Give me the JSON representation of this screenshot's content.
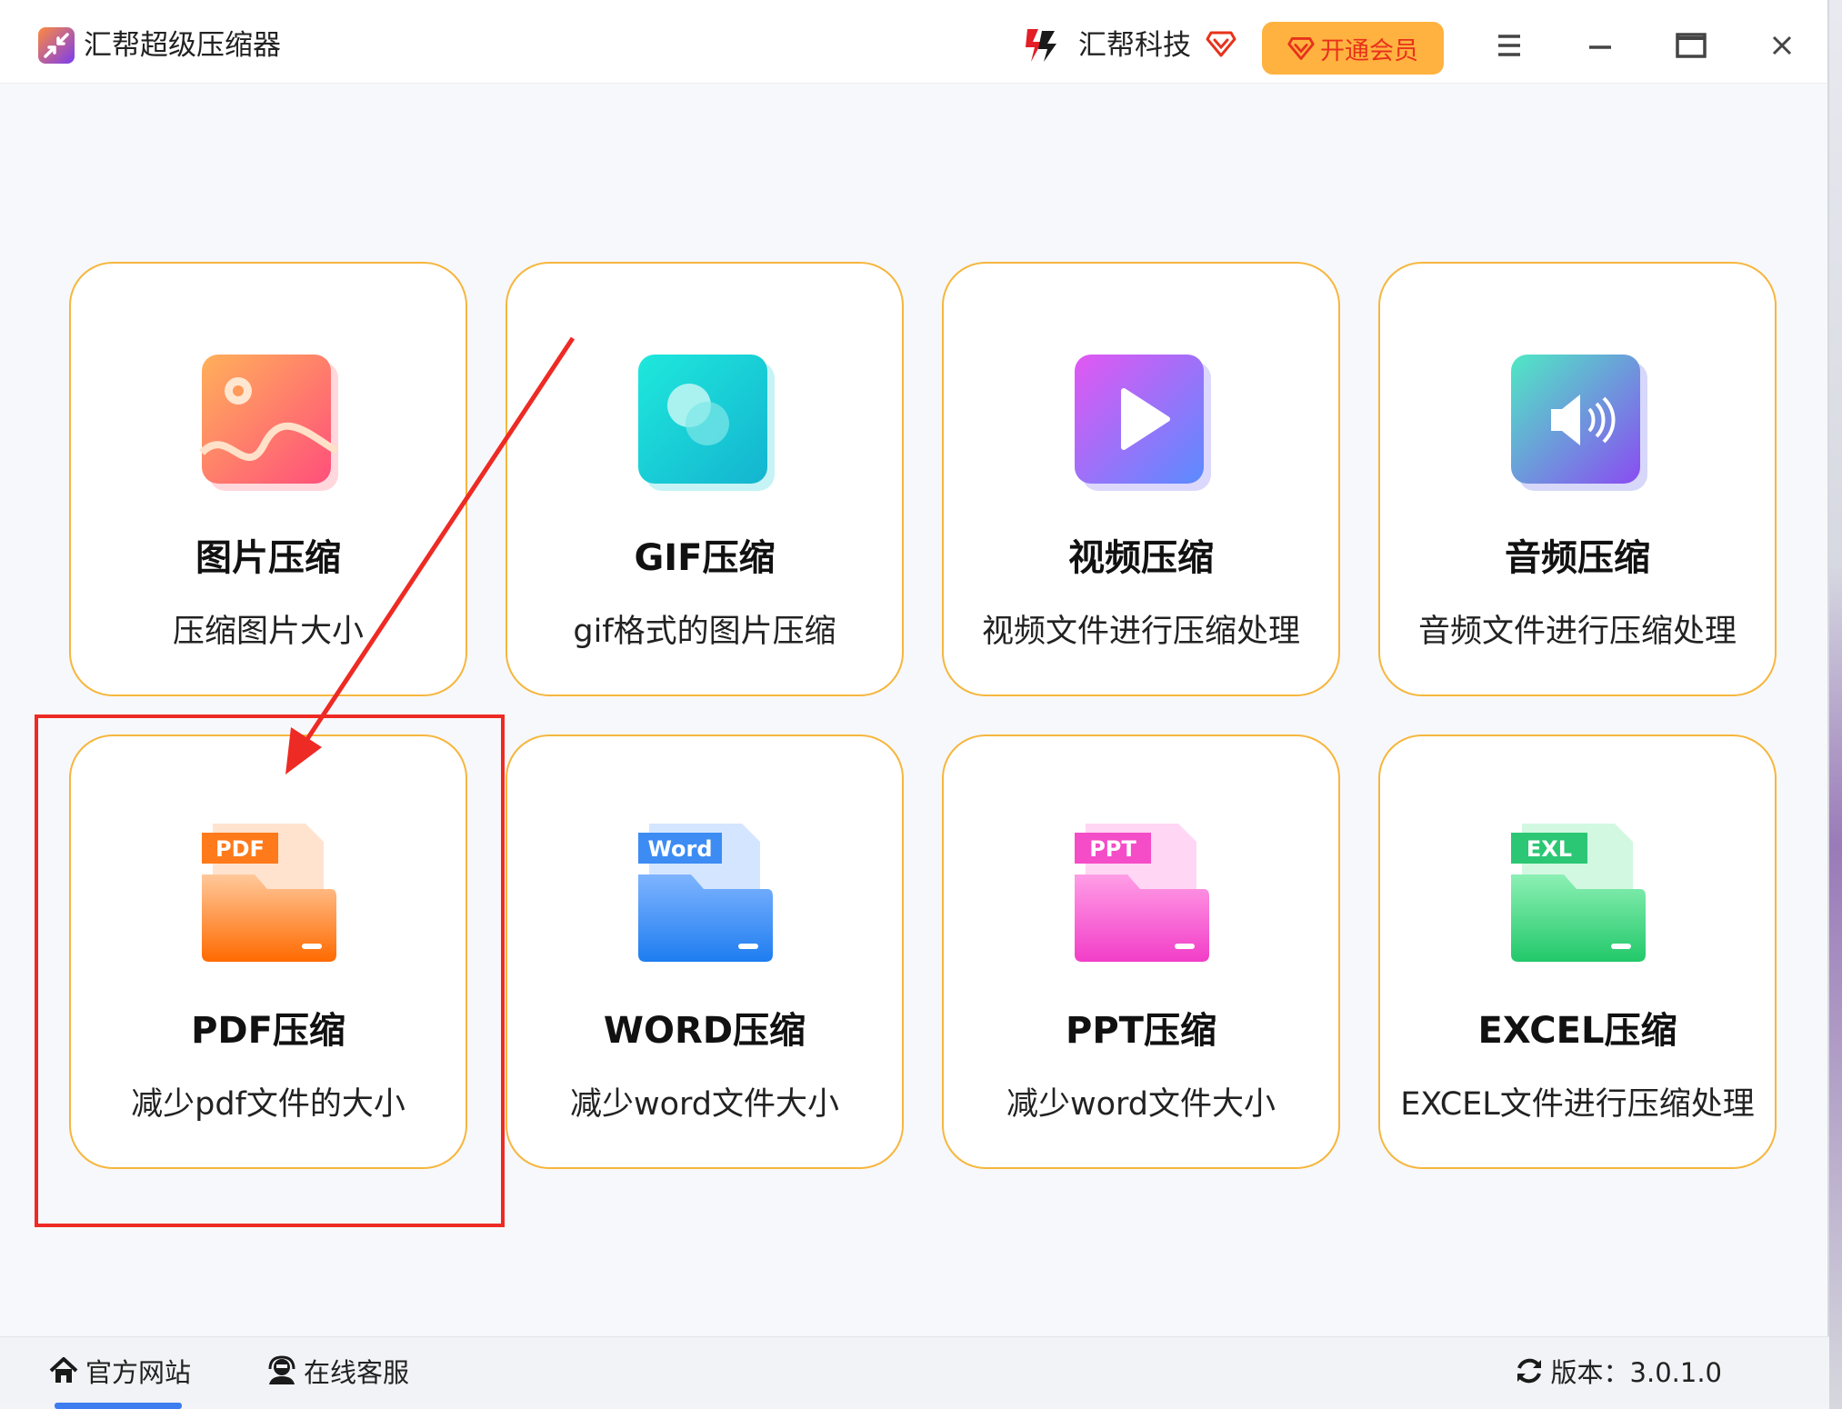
{
  "app": {
    "title": "汇帮超级压缩器"
  },
  "header": {
    "brand_name": "汇帮科技",
    "vip_label": "开通会员"
  },
  "cards": [
    {
      "title": "图片压缩",
      "desc": "压缩图片大小",
      "icon": "image-icon"
    },
    {
      "title": "GIF压缩",
      "desc": "gif格式的图片压缩",
      "icon": "gif-icon"
    },
    {
      "title": "视频压缩",
      "desc": "视频文件进行压缩处理",
      "icon": "video-icon"
    },
    {
      "title": "音频压缩",
      "desc": "音频文件进行压缩处理",
      "icon": "audio-icon"
    },
    {
      "title": "PDF压缩",
      "desc": "减少pdf文件的大小",
      "icon": "pdf-folder-icon",
      "badge": "PDF"
    },
    {
      "title": "WORD压缩",
      "desc": "减少word文件大小",
      "icon": "word-folder-icon",
      "badge": "Word"
    },
    {
      "title": "PPT压缩",
      "desc": "减少word文件大小",
      "icon": "ppt-folder-icon",
      "badge": "PPT"
    },
    {
      "title": "EXCEL压缩",
      "desc": "EXCEL文件进行压缩处理",
      "icon": "excel-folder-icon",
      "badge": "EXL"
    }
  ],
  "footer": {
    "website_label": "官方网站",
    "support_label": "在线客服",
    "version_label": "版本：3.0.1.0"
  },
  "colors": {
    "card_border": "#f6b63d",
    "vip_bg": "#ffb23f",
    "vip_text": "#e8321b",
    "annotation": "#ee2a24"
  }
}
